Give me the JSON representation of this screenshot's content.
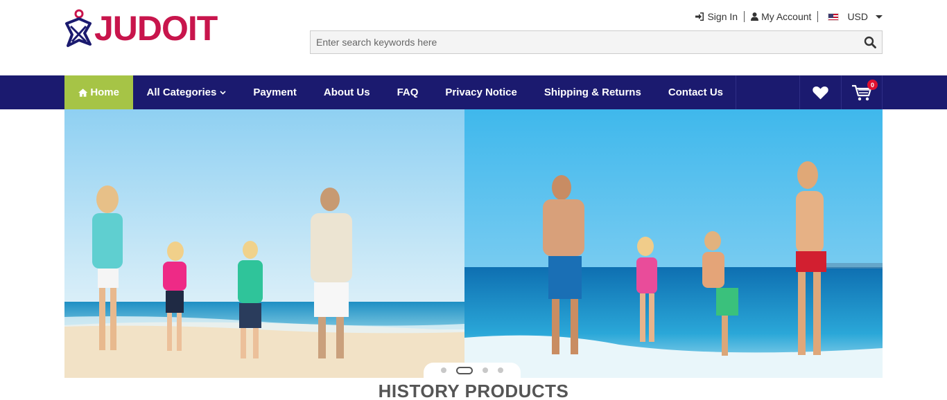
{
  "logo": {
    "text": "JUDOIT",
    "brand_color": "#c8154c",
    "mark_color": "#1b1a6f"
  },
  "topbar": {
    "sign_in": "Sign In",
    "my_account": "My Account",
    "currency": "USD"
  },
  "search": {
    "placeholder": "Enter search keywords here",
    "value": ""
  },
  "nav": {
    "bg_color": "#1b1a6f",
    "home_color": "#a6c446",
    "items": [
      {
        "label": "Home"
      },
      {
        "label": "All Categories"
      },
      {
        "label": "Payment"
      },
      {
        "label": "About Us"
      },
      {
        "label": "FAQ"
      },
      {
        "label": "Privacy Notice"
      },
      {
        "label": "Shipping & Returns"
      },
      {
        "label": "Contact Us"
      }
    ],
    "cart_count": "0",
    "icons": [
      "home-icon",
      "chevron-down-icon",
      "heart-icon",
      "cart-icon"
    ]
  },
  "banner": {
    "slides_total": 4,
    "active_slide": 2
  },
  "section": {
    "title": "HISTORY PRODUCTS"
  }
}
